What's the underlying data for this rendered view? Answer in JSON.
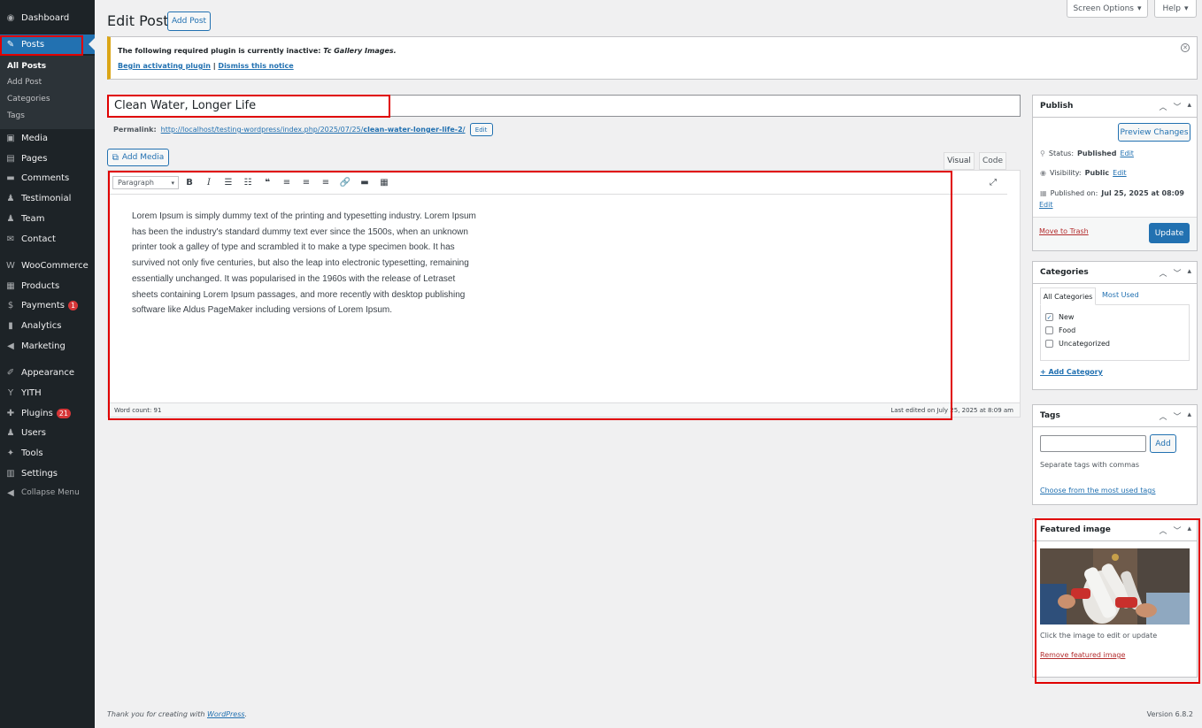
{
  "sidebar": {
    "items": [
      {
        "label": "Dashboard",
        "icon": "dashboard-icon",
        "glyph": "◉"
      },
      {
        "label": "Posts",
        "icon": "pin-icon",
        "glyph": "✎"
      },
      {
        "label": "Media",
        "icon": "media-icon",
        "glyph": "▣"
      },
      {
        "label": "Pages",
        "icon": "pages-icon",
        "glyph": "▤"
      },
      {
        "label": "Comments",
        "icon": "comments-icon",
        "glyph": "▬"
      },
      {
        "label": "Testimonial",
        "icon": "user-icon",
        "glyph": "♟"
      },
      {
        "label": "Team",
        "icon": "user-icon",
        "glyph": "♟"
      },
      {
        "label": "Contact",
        "icon": "mail-icon",
        "glyph": "✉"
      },
      {
        "label": "WooCommerce",
        "icon": "woo-icon",
        "glyph": "W"
      },
      {
        "label": "Products",
        "icon": "archive-icon",
        "glyph": "▦"
      },
      {
        "label": "Payments",
        "icon": "dollar-icon",
        "glyph": "$",
        "badge": "1"
      },
      {
        "label": "Analytics",
        "icon": "chart-bar-icon",
        "glyph": "▮"
      },
      {
        "label": "Marketing",
        "icon": "megaphone-icon",
        "glyph": "◀"
      },
      {
        "label": "Appearance",
        "icon": "brush-icon",
        "glyph": "✐"
      },
      {
        "label": "YITH",
        "icon": "yith-icon",
        "glyph": "Y"
      },
      {
        "label": "Plugins",
        "icon": "plug-icon",
        "glyph": "✚",
        "badge": "21"
      },
      {
        "label": "Users",
        "icon": "users-icon",
        "glyph": "♟"
      },
      {
        "label": "Tools",
        "icon": "wrench-icon",
        "glyph": "✦"
      },
      {
        "label": "Settings",
        "icon": "settings-icon",
        "glyph": "▥"
      },
      {
        "label": "Collapse Menu",
        "icon": "collapse-icon",
        "glyph": "◀"
      }
    ],
    "submenu": [
      "All Posts",
      "Add Post",
      "Categories",
      "Tags"
    ]
  },
  "header": {
    "title": "Edit Post",
    "add_post": "Add Post",
    "screen_options": "Screen Options",
    "help": "Help"
  },
  "notice": {
    "text": "The following required plugin is currently inactive:",
    "plugin": "Tc Gallery Images.",
    "begin": "Begin activating plugin",
    "separator": "|",
    "dismiss": "Dismiss this notice"
  },
  "post": {
    "title": "Clean Water, Longer Life",
    "permalink_label": "Permalink:",
    "permalink_base": "http://localhost/testing-wordpress/index.php/2025/07/25/",
    "permalink_slug": "clean-water-longer-life-2/",
    "permalink_edit": "Edit"
  },
  "editor": {
    "add_media": "Add Media",
    "tab_visual": "Visual",
    "tab_code": "Code",
    "format": "Paragraph",
    "content": "Lorem Ipsum is simply dummy text of the printing and typesetting industry. Lorem Ipsum has been the industry's standard dummy text ever since the 1500s, when an unknown printer took a galley of type and scrambled it to make a type specimen book. It has survived not only five centuries, but also the leap into electronic typesetting, remaining essentially unchanged. It was popularised in the 1960s with the release of Letraset sheets containing Lorem Ipsum passages, and more recently with desktop publishing software like Aldus PageMaker including versions of Lorem Ipsum.",
    "word_count": "Word count: 91",
    "last_edited": "Last edited on July 25, 2025 at 8:09 am"
  },
  "publish": {
    "title": "Publish",
    "preview": "Preview Changes",
    "status_label": "Status:",
    "status_value": "Published",
    "visibility_label": "Visibility:",
    "visibility_value": "Public",
    "published_label": "Published on:",
    "published_value": "Jul 25, 2025 at 08:09",
    "edit": "Edit",
    "trash": "Move to Trash",
    "update": "Update"
  },
  "categories": {
    "title": "Categories",
    "tab_all": "All Categories",
    "tab_most": "Most Used",
    "items": [
      {
        "label": "New",
        "checked": "✓"
      },
      {
        "label": "Food",
        "checked": ""
      },
      {
        "label": "Uncategorized",
        "checked": ""
      }
    ],
    "add": "+ Add Category"
  },
  "tags": {
    "title": "Tags",
    "add": "Add",
    "hint": "Separate tags with commas",
    "choose": "Choose from the most used tags"
  },
  "featured": {
    "title": "Featured image",
    "hint": "Click the image to edit or update",
    "remove": "Remove featured image"
  },
  "footer": {
    "thanks": "Thank you for creating with",
    "wp": "WordPress",
    "period": ".",
    "version": "Version 6.8.2"
  },
  "colors": {
    "accent": "#2271b1",
    "sidebar": "#1d2327",
    "highlight": "#e00000"
  }
}
